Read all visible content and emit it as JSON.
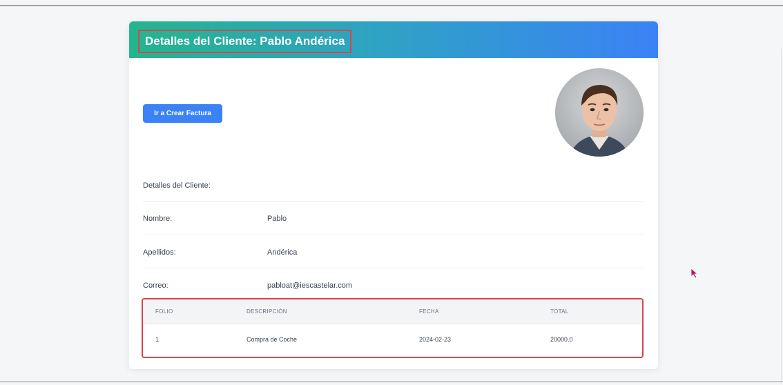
{
  "header": {
    "title": "Detalles del Cliente: Pablo Andérica"
  },
  "actions": {
    "create_invoice_label": "Ir a Crear Factura"
  },
  "details": {
    "section_title": "Detalles del Cliente:",
    "rows": [
      {
        "label": "Nombre:",
        "value": "Pablo"
      },
      {
        "label": "Apellidos:",
        "value": "Andérica"
      },
      {
        "label": "Correo:",
        "value": "pabloat@iescastelar.com"
      }
    ]
  },
  "invoices": {
    "columns": [
      "FOLIO",
      "DESCRIPCIÓN",
      "FECHA",
      "TOTAL"
    ],
    "rows": [
      [
        "1",
        "Compra de Coche",
        "2024-02-23",
        "20000.0"
      ]
    ]
  },
  "colors": {
    "header_gradient_start": "#24b58d",
    "header_gradient_end": "#3b82f6",
    "button": "#3b82f6",
    "highlight_border": "#d64550"
  }
}
